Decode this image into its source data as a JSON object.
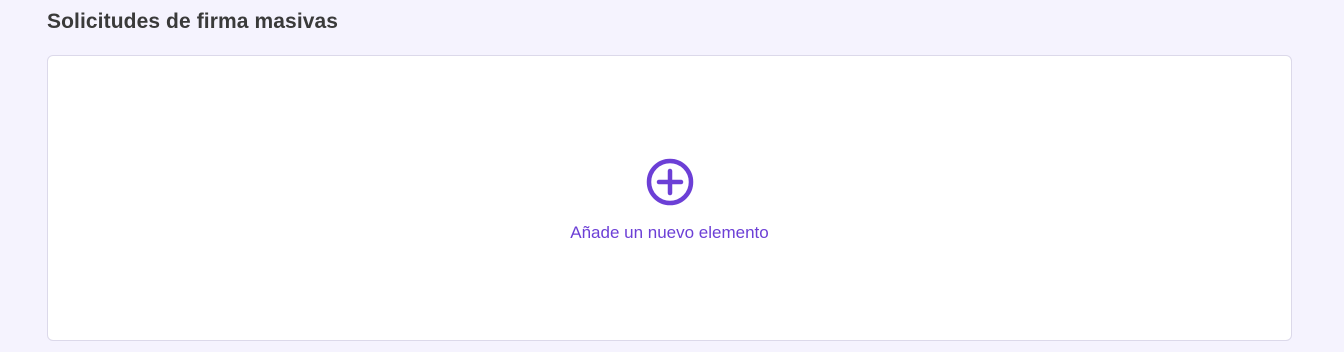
{
  "section": {
    "title": "Solicitudes de firma masivas"
  },
  "add_element": {
    "label": "Añade un nuevo elemento",
    "icon": "plus-circle-icon"
  },
  "colors": {
    "background": "#f5f3fe",
    "accent": "#6c3fd6",
    "title_text": "#3a3a3a",
    "card_border": "#dcd9ea"
  }
}
